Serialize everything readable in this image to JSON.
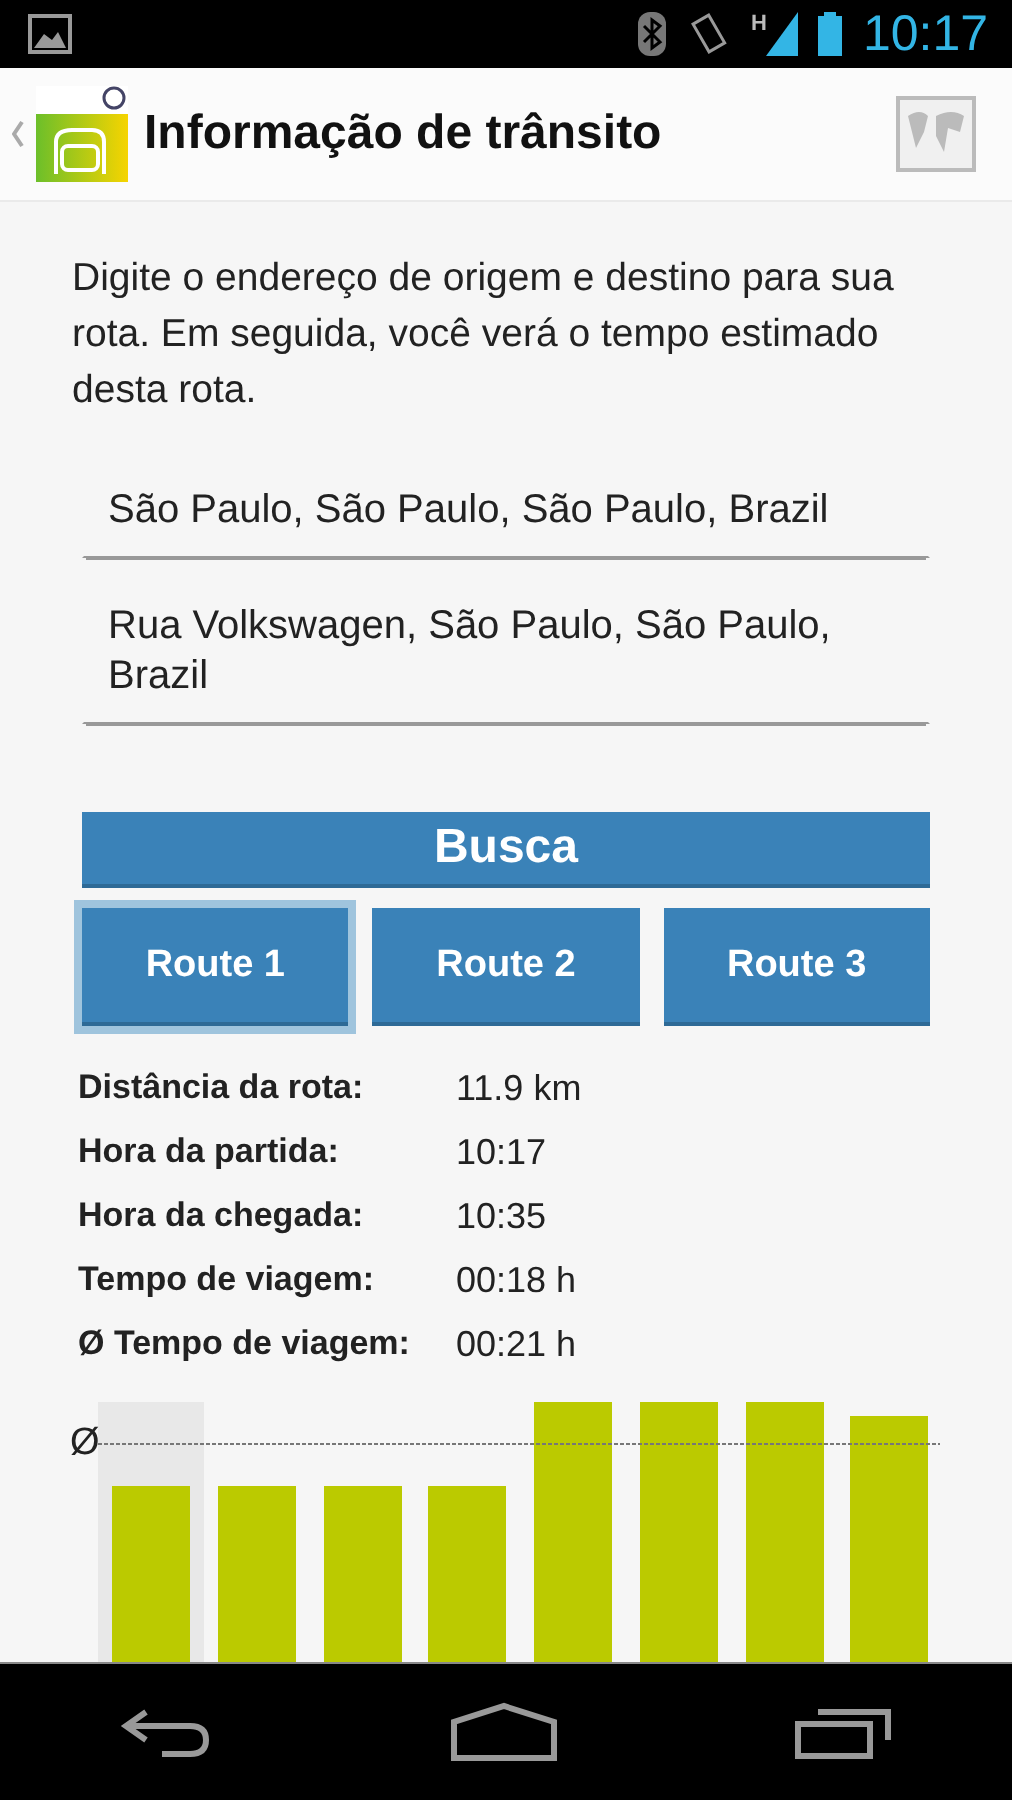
{
  "status_bar": {
    "time": "10:17",
    "network": "H"
  },
  "action_bar": {
    "title": "Informação de trânsito"
  },
  "intro": "Digite o endereço de origem e destino para sua rota. Em seguida, você verá o tempo estimado desta rota.",
  "fields": [
    {
      "value": "São Paulo, São Paulo, São Paulo, Brazil"
    },
    {
      "value": "Rua Volkswagen, São Paulo, São Paulo, Brazil"
    }
  ],
  "search_button": "Busca",
  "routes": [
    {
      "label": "Route 1",
      "selected": true
    },
    {
      "label": "Route 2",
      "selected": false
    },
    {
      "label": "Route 3",
      "selected": false
    }
  ],
  "details": [
    {
      "label": "Distância da rota:",
      "value": "11.9 km"
    },
    {
      "label": "Hora da partida:",
      "value": "10:17"
    },
    {
      "label": "Hora da chegada:",
      "value": "10:35"
    },
    {
      "label": "Tempo de viagem:",
      "value": "00:18 h"
    },
    {
      "label": "Ø Tempo de viagem:",
      "value": "00:21 h"
    }
  ],
  "chart": {
    "average_label": "Ø"
  }
}
